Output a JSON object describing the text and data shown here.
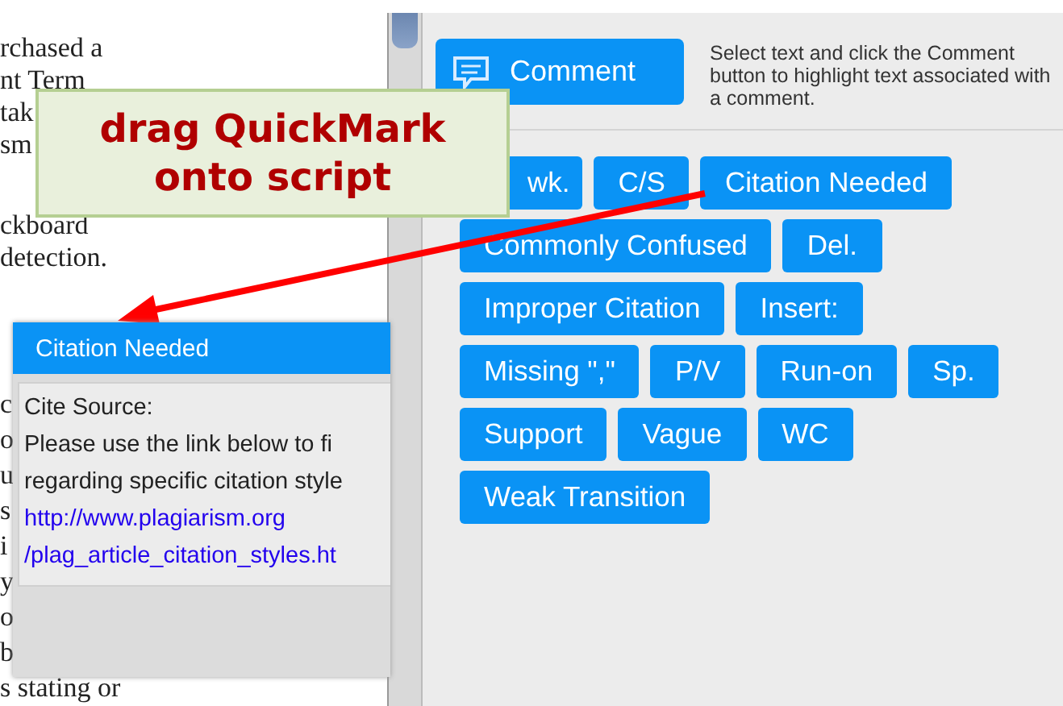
{
  "document": {
    "paragraphs": [
      [
        "rchased a",
        "nt Term",
        "tak",
        "sm"
      ],
      [
        "ckboard",
        "detection."
      ],
      [
        "c",
        "o",
        "u",
        "s",
        "i",
        "y",
        "o",
        "b",
        "s stating or"
      ]
    ]
  },
  "comment_button": {
    "label": "Comment"
  },
  "help_text": "Select text and click the Comment button to highlight text associated with a comment.",
  "quickmarks": [
    [
      "wk.",
      "C/S",
      "Citation Needed"
    ],
    [
      "Commonly Confused",
      "Del."
    ],
    [
      "Improper Citation",
      "Insert:"
    ],
    [
      "Missing \",\"",
      "P/V",
      "Run-on",
      "Sp."
    ],
    [
      "Support",
      "Vague",
      "WC"
    ],
    [
      "Weak Transition"
    ]
  ],
  "callout": {
    "lines": [
      "drag QuickMark",
      "onto script"
    ]
  },
  "popup": {
    "title": "Citation Needed",
    "lines": [
      "Cite Source:",
      "Please use the link below to fi",
      "regarding specific citation style"
    ],
    "links": [
      "http://www.plagiarism.org",
      "/plag_article_citation_styles.ht"
    ]
  }
}
